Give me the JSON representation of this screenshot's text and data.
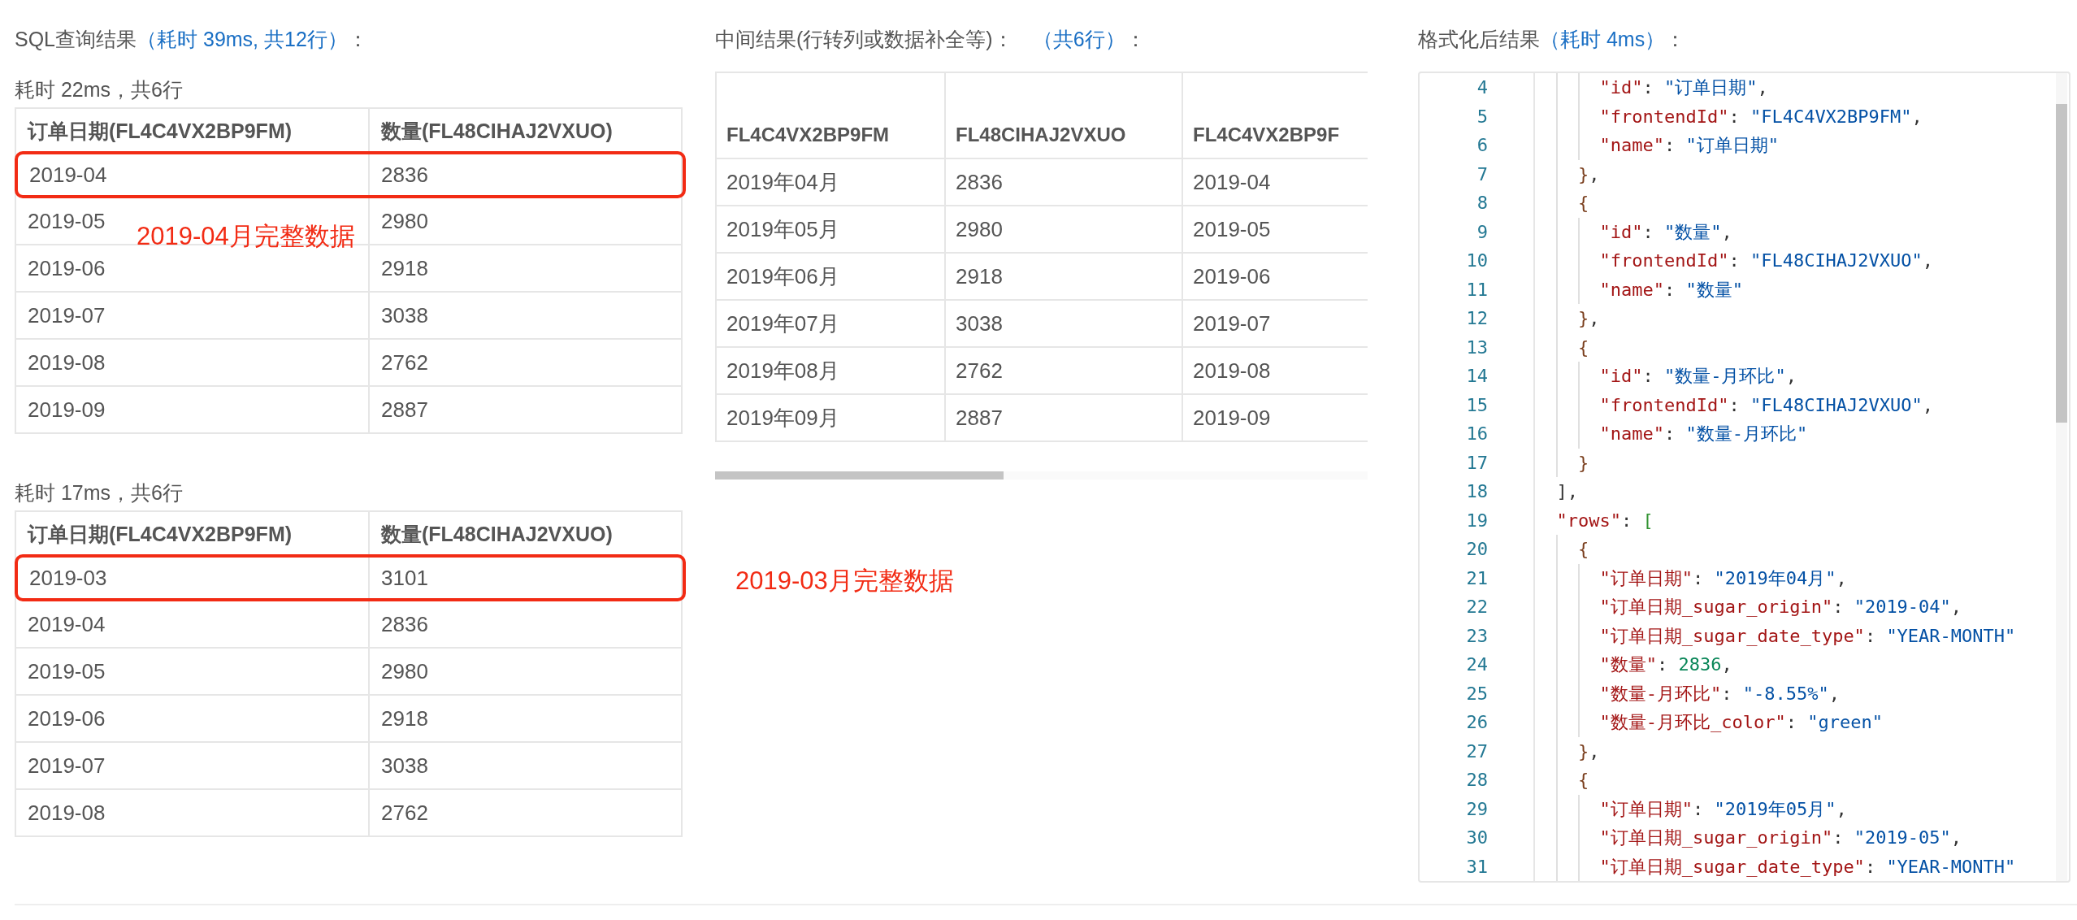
{
  "sql_result": {
    "title": "SQL查询结果",
    "detail": "（耗时 39ms, 共12行）",
    "suffix": "：",
    "tables": [
      {
        "caption": "耗时 22ms，共6行",
        "columns": [
          "订单日期(FL4C4VX2BP9FM)",
          "数量(FL48CIHAJ2VXUO)"
        ],
        "note": "2019-04月完整数据",
        "rows": [
          {
            "cells": [
              "2019-04",
              "2836"
            ],
            "highlighted": true
          },
          {
            "cells": [
              "2019-05",
              "2980"
            ],
            "highlighted": false
          },
          {
            "cells": [
              "2019-06",
              "2918"
            ],
            "highlighted": false
          },
          {
            "cells": [
              "2019-07",
              "3038"
            ],
            "highlighted": false
          },
          {
            "cells": [
              "2019-08",
              "2762"
            ],
            "highlighted": false
          },
          {
            "cells": [
              "2019-09",
              "2887"
            ],
            "highlighted": false
          }
        ]
      },
      {
        "caption": "耗时 17ms，共6行",
        "columns": [
          "订单日期(FL4C4VX2BP9FM)",
          "数量(FL48CIHAJ2VXUO)"
        ],
        "note": "2019-03月完整数据",
        "rows": [
          {
            "cells": [
              "2019-03",
              "3101"
            ],
            "highlighted": true
          },
          {
            "cells": [
              "2019-04",
              "2836"
            ],
            "highlighted": false
          },
          {
            "cells": [
              "2019-05",
              "2980"
            ],
            "highlighted": false
          },
          {
            "cells": [
              "2019-06",
              "2918"
            ],
            "highlighted": false
          },
          {
            "cells": [
              "2019-07",
              "3038"
            ],
            "highlighted": false
          },
          {
            "cells": [
              "2019-08",
              "2762"
            ],
            "highlighted": false
          }
        ]
      }
    ]
  },
  "intermediate": {
    "title": "中间结果(行转列或数据补全等)：",
    "detail": "（共6行）",
    "suffix": "：",
    "columns": [
      "FL4C4VX2BP9FM",
      "FL48CIHAJ2VXUO",
      "FL4C4VX2BP9F"
    ],
    "rows": [
      [
        "2019年04月",
        "2836",
        "2019-04"
      ],
      [
        "2019年05月",
        "2980",
        "2019-05"
      ],
      [
        "2019年06月",
        "2918",
        "2019-06"
      ],
      [
        "2019年07月",
        "3038",
        "2019-07"
      ],
      [
        "2019年08月",
        "2762",
        "2019-08"
      ],
      [
        "2019年09月",
        "2887",
        "2019-09"
      ]
    ]
  },
  "formatted": {
    "title": "格式化后结果",
    "detail": "（耗时 4ms）",
    "suffix": "：",
    "lines": [
      {
        "num": "4",
        "tokens": [
          {
            "kind": "key",
            "text": "      \"id\""
          },
          {
            "kind": "punct",
            "text": ": "
          },
          {
            "kind": "string",
            "text": "\"订单日期\""
          },
          {
            "kind": "punct",
            "text": ","
          }
        ]
      },
      {
        "num": "5",
        "tokens": [
          {
            "kind": "key",
            "text": "      \"frontendId\""
          },
          {
            "kind": "punct",
            "text": ": "
          },
          {
            "kind": "string",
            "text": "\"FL4C4VX2BP9FM\""
          },
          {
            "kind": "punct",
            "text": ","
          }
        ]
      },
      {
        "num": "6",
        "tokens": [
          {
            "kind": "key",
            "text": "      \"name\""
          },
          {
            "kind": "punct",
            "text": ": "
          },
          {
            "kind": "string",
            "text": "\"订单日期\""
          }
        ]
      },
      {
        "num": "7",
        "tokens": [
          {
            "kind": "brace",
            "text": "    }"
          },
          {
            "kind": "punct",
            "text": ","
          }
        ]
      },
      {
        "num": "8",
        "tokens": [
          {
            "kind": "brace",
            "text": "    {"
          }
        ]
      },
      {
        "num": "9",
        "tokens": [
          {
            "kind": "key",
            "text": "      \"id\""
          },
          {
            "kind": "punct",
            "text": ": "
          },
          {
            "kind": "string",
            "text": "\"数量\""
          },
          {
            "kind": "punct",
            "text": ","
          }
        ]
      },
      {
        "num": "10",
        "tokens": [
          {
            "kind": "key",
            "text": "      \"frontendId\""
          },
          {
            "kind": "punct",
            "text": ": "
          },
          {
            "kind": "string",
            "text": "\"FL48CIHAJ2VXUO\""
          },
          {
            "kind": "punct",
            "text": ","
          }
        ]
      },
      {
        "num": "11",
        "tokens": [
          {
            "kind": "key",
            "text": "      \"name\""
          },
          {
            "kind": "punct",
            "text": ": "
          },
          {
            "kind": "string",
            "text": "\"数量\""
          }
        ]
      },
      {
        "num": "12",
        "tokens": [
          {
            "kind": "brace",
            "text": "    }"
          },
          {
            "kind": "punct",
            "text": ","
          }
        ]
      },
      {
        "num": "13",
        "tokens": [
          {
            "kind": "brace",
            "text": "    {"
          }
        ]
      },
      {
        "num": "14",
        "tokens": [
          {
            "kind": "key",
            "text": "      \"id\""
          },
          {
            "kind": "punct",
            "text": ": "
          },
          {
            "kind": "string",
            "text": "\"数量-月环比\""
          },
          {
            "kind": "punct",
            "text": ","
          }
        ]
      },
      {
        "num": "15",
        "tokens": [
          {
            "kind": "key",
            "text": "      \"frontendId\""
          },
          {
            "kind": "punct",
            "text": ": "
          },
          {
            "kind": "string",
            "text": "\"FL48CIHAJ2VXUO\""
          },
          {
            "kind": "punct",
            "text": ","
          }
        ]
      },
      {
        "num": "16",
        "tokens": [
          {
            "kind": "key",
            "text": "      \"name\""
          },
          {
            "kind": "punct",
            "text": ": "
          },
          {
            "kind": "string",
            "text": "\"数量-月环比\""
          }
        ]
      },
      {
        "num": "17",
        "tokens": [
          {
            "kind": "brace",
            "text": "    }"
          }
        ]
      },
      {
        "num": "18",
        "tokens": [
          {
            "kind": "punct",
            "text": "  ],"
          }
        ]
      },
      {
        "num": "19",
        "tokens": [
          {
            "kind": "key",
            "text": "  \"rows\""
          },
          {
            "kind": "punct",
            "text": ": "
          },
          {
            "kind": "bracket",
            "text": "["
          }
        ]
      },
      {
        "num": "20",
        "tokens": [
          {
            "kind": "brace",
            "text": "    {"
          }
        ]
      },
      {
        "num": "21",
        "tokens": [
          {
            "kind": "key",
            "text": "      \"订单日期\""
          },
          {
            "kind": "punct",
            "text": ": "
          },
          {
            "kind": "string",
            "text": "\"2019年04月\""
          },
          {
            "kind": "punct",
            "text": ","
          }
        ]
      },
      {
        "num": "22",
        "tokens": [
          {
            "kind": "key",
            "text": "      \"订单日期_sugar_origin\""
          },
          {
            "kind": "punct",
            "text": ": "
          },
          {
            "kind": "string",
            "text": "\"2019-04\""
          },
          {
            "kind": "punct",
            "text": ","
          }
        ]
      },
      {
        "num": "23",
        "tokens": [
          {
            "kind": "key",
            "text": "      \"订单日期_sugar_date_type\""
          },
          {
            "kind": "punct",
            "text": ": "
          },
          {
            "kind": "string",
            "text": "\"YEAR-MONTH\""
          }
        ]
      },
      {
        "num": "24",
        "tokens": [
          {
            "kind": "key",
            "text": "      \"数量\""
          },
          {
            "kind": "punct",
            "text": ": "
          },
          {
            "kind": "number",
            "text": "2836"
          },
          {
            "kind": "punct",
            "text": ","
          }
        ]
      },
      {
        "num": "25",
        "tokens": [
          {
            "kind": "key",
            "text": "      \"数量-月环比\""
          },
          {
            "kind": "punct",
            "text": ": "
          },
          {
            "kind": "string",
            "text": "\"-8.55%\""
          },
          {
            "kind": "punct",
            "text": ","
          }
        ]
      },
      {
        "num": "26",
        "tokens": [
          {
            "kind": "key",
            "text": "      \"数量-月环比_color\""
          },
          {
            "kind": "punct",
            "text": ": "
          },
          {
            "kind": "string",
            "text": "\"green\""
          }
        ]
      },
      {
        "num": "27",
        "tokens": [
          {
            "kind": "brace",
            "text": "    }"
          },
          {
            "kind": "punct",
            "text": ","
          }
        ]
      },
      {
        "num": "28",
        "tokens": [
          {
            "kind": "brace",
            "text": "    {"
          }
        ]
      },
      {
        "num": "29",
        "tokens": [
          {
            "kind": "key",
            "text": "      \"订单日期\""
          },
          {
            "kind": "punct",
            "text": ": "
          },
          {
            "kind": "string",
            "text": "\"2019年05月\""
          },
          {
            "kind": "punct",
            "text": ","
          }
        ]
      },
      {
        "num": "30",
        "tokens": [
          {
            "kind": "key",
            "text": "      \"订单日期_sugar_origin\""
          },
          {
            "kind": "punct",
            "text": ": "
          },
          {
            "kind": "string",
            "text": "\"2019-05\""
          },
          {
            "kind": "punct",
            "text": ","
          }
        ]
      },
      {
        "num": "31",
        "tokens": [
          {
            "kind": "key",
            "text": "      \"订单日期_sugar_date_type\""
          },
          {
            "kind": "punct",
            "text": ": "
          },
          {
            "kind": "string",
            "text": "\"YEAR-MONTH\""
          }
        ]
      }
    ]
  }
}
